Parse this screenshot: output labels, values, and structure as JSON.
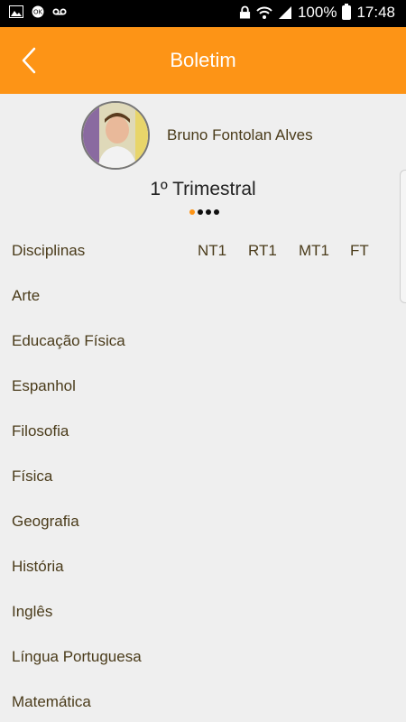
{
  "status_bar": {
    "battery": "100%",
    "time": "17:48",
    "left_icons": [
      "image-icon",
      "ok-icon",
      "voicemail-icon"
    ],
    "right_icons": [
      "lock-icon",
      "wifi-icon",
      "signal-icon",
      "battery-icon"
    ]
  },
  "header": {
    "title": "Boletim",
    "back_icon": "chevron-left-icon",
    "color": "#fd9416"
  },
  "student": {
    "name": "Bruno Fontolan Alves"
  },
  "period": {
    "label": "1º Trimestral",
    "pager_total": 4,
    "pager_active": 1
  },
  "table": {
    "header": {
      "disciplina": "Disciplinas",
      "nt1": "NT1",
      "rt1": "RT1",
      "mt1": "MT1",
      "ft": "FT"
    },
    "subjects": [
      "Arte",
      "Educação Física",
      "Espanhol",
      "Filosofia",
      "Física",
      "Geografia",
      "História",
      "Inglês",
      "Língua Portuguesa",
      "Matemática"
    ]
  }
}
